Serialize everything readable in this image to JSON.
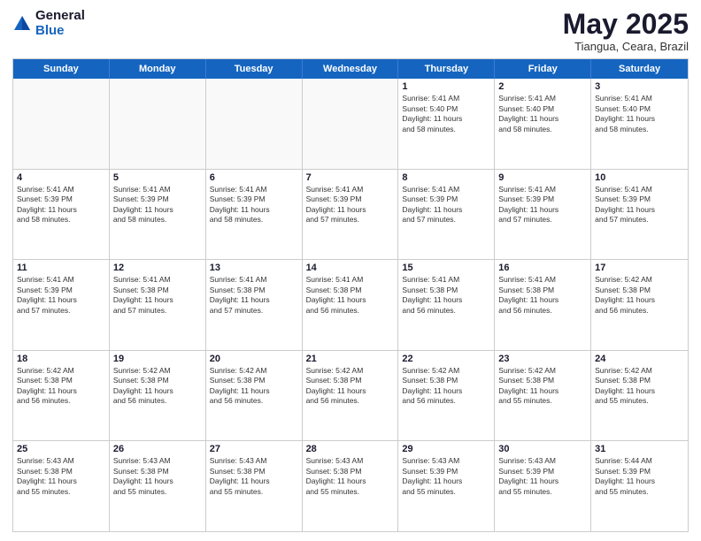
{
  "logo": {
    "general": "General",
    "blue": "Blue"
  },
  "header": {
    "month": "May 2025",
    "location": "Tiangua, Ceara, Brazil"
  },
  "weekdays": [
    "Sunday",
    "Monday",
    "Tuesday",
    "Wednesday",
    "Thursday",
    "Friday",
    "Saturday"
  ],
  "rows": [
    [
      {
        "day": "",
        "text": ""
      },
      {
        "day": "",
        "text": ""
      },
      {
        "day": "",
        "text": ""
      },
      {
        "day": "",
        "text": ""
      },
      {
        "day": "1",
        "text": "Sunrise: 5:41 AM\nSunset: 5:40 PM\nDaylight: 11 hours\nand 58 minutes."
      },
      {
        "day": "2",
        "text": "Sunrise: 5:41 AM\nSunset: 5:40 PM\nDaylight: 11 hours\nand 58 minutes."
      },
      {
        "day": "3",
        "text": "Sunrise: 5:41 AM\nSunset: 5:40 PM\nDaylight: 11 hours\nand 58 minutes."
      }
    ],
    [
      {
        "day": "4",
        "text": "Sunrise: 5:41 AM\nSunset: 5:39 PM\nDaylight: 11 hours\nand 58 minutes."
      },
      {
        "day": "5",
        "text": "Sunrise: 5:41 AM\nSunset: 5:39 PM\nDaylight: 11 hours\nand 58 minutes."
      },
      {
        "day": "6",
        "text": "Sunrise: 5:41 AM\nSunset: 5:39 PM\nDaylight: 11 hours\nand 58 minutes."
      },
      {
        "day": "7",
        "text": "Sunrise: 5:41 AM\nSunset: 5:39 PM\nDaylight: 11 hours\nand 57 minutes."
      },
      {
        "day": "8",
        "text": "Sunrise: 5:41 AM\nSunset: 5:39 PM\nDaylight: 11 hours\nand 57 minutes."
      },
      {
        "day": "9",
        "text": "Sunrise: 5:41 AM\nSunset: 5:39 PM\nDaylight: 11 hours\nand 57 minutes."
      },
      {
        "day": "10",
        "text": "Sunrise: 5:41 AM\nSunset: 5:39 PM\nDaylight: 11 hours\nand 57 minutes."
      }
    ],
    [
      {
        "day": "11",
        "text": "Sunrise: 5:41 AM\nSunset: 5:39 PM\nDaylight: 11 hours\nand 57 minutes."
      },
      {
        "day": "12",
        "text": "Sunrise: 5:41 AM\nSunset: 5:38 PM\nDaylight: 11 hours\nand 57 minutes."
      },
      {
        "day": "13",
        "text": "Sunrise: 5:41 AM\nSunset: 5:38 PM\nDaylight: 11 hours\nand 57 minutes."
      },
      {
        "day": "14",
        "text": "Sunrise: 5:41 AM\nSunset: 5:38 PM\nDaylight: 11 hours\nand 56 minutes."
      },
      {
        "day": "15",
        "text": "Sunrise: 5:41 AM\nSunset: 5:38 PM\nDaylight: 11 hours\nand 56 minutes."
      },
      {
        "day": "16",
        "text": "Sunrise: 5:41 AM\nSunset: 5:38 PM\nDaylight: 11 hours\nand 56 minutes."
      },
      {
        "day": "17",
        "text": "Sunrise: 5:42 AM\nSunset: 5:38 PM\nDaylight: 11 hours\nand 56 minutes."
      }
    ],
    [
      {
        "day": "18",
        "text": "Sunrise: 5:42 AM\nSunset: 5:38 PM\nDaylight: 11 hours\nand 56 minutes."
      },
      {
        "day": "19",
        "text": "Sunrise: 5:42 AM\nSunset: 5:38 PM\nDaylight: 11 hours\nand 56 minutes."
      },
      {
        "day": "20",
        "text": "Sunrise: 5:42 AM\nSunset: 5:38 PM\nDaylight: 11 hours\nand 56 minutes."
      },
      {
        "day": "21",
        "text": "Sunrise: 5:42 AM\nSunset: 5:38 PM\nDaylight: 11 hours\nand 56 minutes."
      },
      {
        "day": "22",
        "text": "Sunrise: 5:42 AM\nSunset: 5:38 PM\nDaylight: 11 hours\nand 56 minutes."
      },
      {
        "day": "23",
        "text": "Sunrise: 5:42 AM\nSunset: 5:38 PM\nDaylight: 11 hours\nand 55 minutes."
      },
      {
        "day": "24",
        "text": "Sunrise: 5:42 AM\nSunset: 5:38 PM\nDaylight: 11 hours\nand 55 minutes."
      }
    ],
    [
      {
        "day": "25",
        "text": "Sunrise: 5:43 AM\nSunset: 5:38 PM\nDaylight: 11 hours\nand 55 minutes."
      },
      {
        "day": "26",
        "text": "Sunrise: 5:43 AM\nSunset: 5:38 PM\nDaylight: 11 hours\nand 55 minutes."
      },
      {
        "day": "27",
        "text": "Sunrise: 5:43 AM\nSunset: 5:38 PM\nDaylight: 11 hours\nand 55 minutes."
      },
      {
        "day": "28",
        "text": "Sunrise: 5:43 AM\nSunset: 5:38 PM\nDaylight: 11 hours\nand 55 minutes."
      },
      {
        "day": "29",
        "text": "Sunrise: 5:43 AM\nSunset: 5:39 PM\nDaylight: 11 hours\nand 55 minutes."
      },
      {
        "day": "30",
        "text": "Sunrise: 5:43 AM\nSunset: 5:39 PM\nDaylight: 11 hours\nand 55 minutes."
      },
      {
        "day": "31",
        "text": "Sunrise: 5:44 AM\nSunset: 5:39 PM\nDaylight: 11 hours\nand 55 minutes."
      }
    ]
  ]
}
